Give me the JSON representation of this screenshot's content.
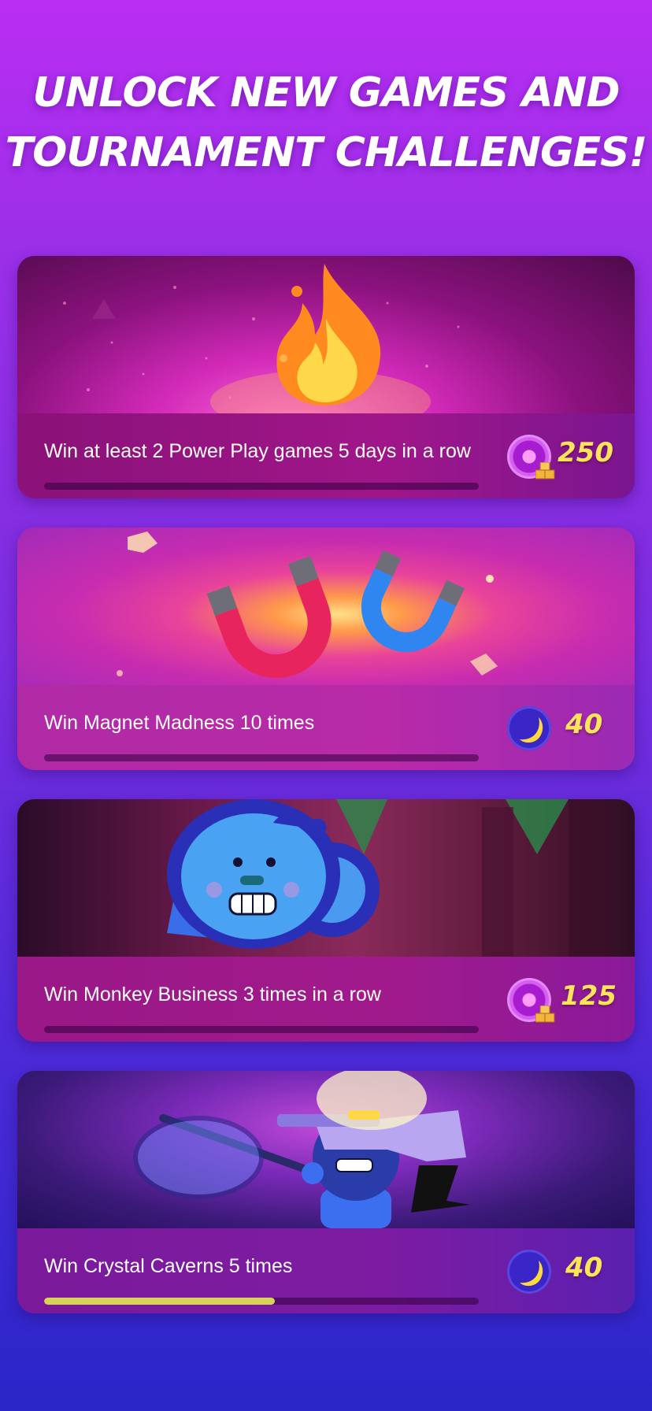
{
  "headline": {
    "line1": "UNLOCK NEW GAMES AND",
    "line2": "TOURNAMENT CHALLENGES!"
  },
  "challenges": [
    {
      "label": "Win at least 2 Power Play games 5 days in a row",
      "reward": "250",
      "reward_icon": "coin-icon",
      "progress": 0.0,
      "art": "flame"
    },
    {
      "label": "Win Magnet Madness 10 times",
      "reward": "40",
      "reward_icon": "moon-icon",
      "progress": 0.0,
      "art": "magnets"
    },
    {
      "label": "Win Monkey Business 3 times in a row",
      "reward": "125",
      "reward_icon": "coin-icon",
      "progress": 0.0,
      "art": "monkey"
    },
    {
      "label": "Win Crystal Caverns 5 times",
      "reward": "40",
      "reward_icon": "moon-icon",
      "progress": 0.53,
      "art": "miner"
    }
  ],
  "colors": {
    "reward_text": "#ffe45a",
    "progress_fill": "#d9d25a"
  }
}
